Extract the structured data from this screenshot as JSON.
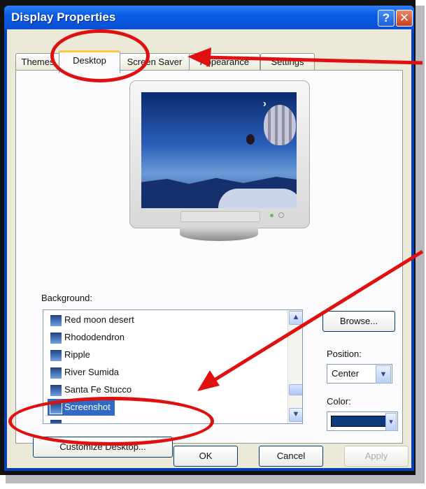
{
  "window": {
    "title": "Display Properties",
    "help_glyph": "?",
    "close_glyph": "✕"
  },
  "tabs": [
    "Themes",
    "Desktop",
    "Screen Saver",
    "Appearance",
    "Settings"
  ],
  "active_tab": "Desktop",
  "background": {
    "label": "Background:",
    "items": [
      "Red moon desert",
      "Rhododendron",
      "Ripple",
      "River Sumida",
      "Santa Fe Stucco",
      "Screenshot"
    ],
    "selected": "Screenshot"
  },
  "buttons": {
    "browse": "Browse...",
    "customize": "Customize Desktop...",
    "ok": "OK",
    "cancel": "Cancel",
    "apply": "Apply"
  },
  "position": {
    "label": "Position:",
    "value": "Center"
  },
  "color": {
    "label": "Color:",
    "swatch_hex": "#0a3b7c"
  },
  "annotation_color": "#e01010"
}
